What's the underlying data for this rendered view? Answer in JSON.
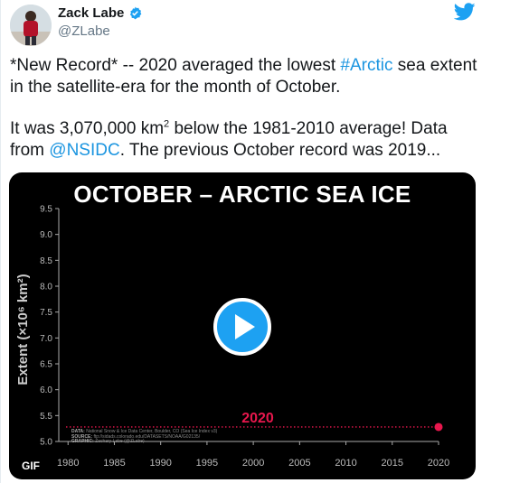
{
  "author": {
    "display_name": "Zack Labe",
    "handle": "@ZLabe",
    "avatar_icon": "person-red-jacket-avatar",
    "verified_icon": "verified-badge-icon",
    "brand_color": "#1da1f2"
  },
  "tweet": {
    "p1_pre": "*New Record* -- 2020 averaged the lowest ",
    "p1_hashtag": "#Arctic",
    "p1_post_line1": " sea extent",
    "p1_line2": "in the satellite-era for the month of October.",
    "p2_pre": "It was 3,070,000 km",
    "p2_sup": "2",
    "p2_mid": " below the 1981-2010 average! Data",
    "p2_from": "from ",
    "p2_mention": "@NSIDC",
    "p2_post": ". The previous October record was 2019...",
    "link_color": "#1b95e0"
  },
  "media": {
    "gif_label": "GIF",
    "play_icon": "play-icon",
    "credits": {
      "data_label": "DATA:",
      "data_text": "National Snow & Ice Data Center, Boulder, CO (Sea Ice Index v3)",
      "source_label": "SOURCE:",
      "source_text": "ftp://sidads.colorado.edu/DATASETS/NOAA/G02135/",
      "graphic_label": "GRAPHIC:",
      "graphic_text": "Zachary Labe (@ZLabe)"
    }
  },
  "chart_data": {
    "type": "line",
    "title": "OCTOBER – ARCTIC SEA ICE",
    "ylabel": "Extent (×10⁶ km²)",
    "xlabel": "",
    "x_ticks": [
      1980,
      1985,
      1990,
      1995,
      2000,
      2005,
      2010,
      2015,
      2020
    ],
    "y_ticks": [
      "5.0",
      "5.5",
      "6.0",
      "6.5",
      "7.0",
      "7.5",
      "8.0",
      "8.5",
      "9.0",
      "9.5"
    ],
    "xlim": [
      1979,
      2020
    ],
    "ylim": [
      5.0,
      9.5
    ],
    "series": [
      {
        "name": "2020",
        "color": "#e8174d",
        "x": [
          2020
        ],
        "y": [
          5.28
        ]
      }
    ],
    "reference_line": {
      "value": 5.28,
      "style": "dotted",
      "color": "#e8174d"
    },
    "grid": false
  }
}
